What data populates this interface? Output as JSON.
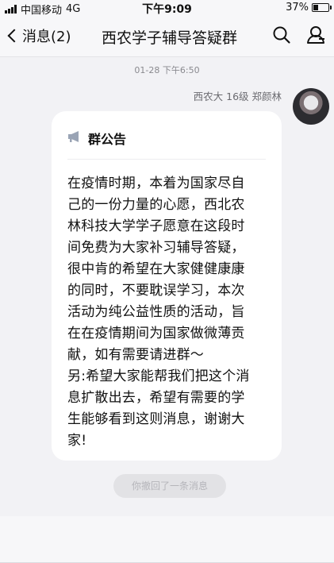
{
  "status_bar": {
    "carrier": "中国移动",
    "network": "4G",
    "time": "下午9:09",
    "battery": "37%",
    "battery_level": 0.37
  },
  "nav": {
    "back_label": "消息(2)",
    "title": "西农学子辅导答疑群",
    "icons": [
      "search-icon",
      "group-members-icon"
    ]
  },
  "chat": {
    "timestamp": "01-28 下午6:50",
    "sender": "西农大 16级 郑颜林",
    "announcement": {
      "icon": "megaphone-icon",
      "title": "群公告",
      "lines": [
        "在疫情时期，本着为国家尽自",
        "己的一份力量的心愿，西北农",
        "林科技大学学子愿意在这段时",
        "间免费为大家补习辅导答疑，",
        "很中肯的希望在大家健健康康",
        "的同时，不要耽误学习，本次",
        "活动为纯公益性质的活动，旨",
        "在在疫情期间为国家做微薄贡",
        "献，如有需要请进群～",
        "另:希望大家能帮我们把这个消",
        "息扩散出去，希望有需要的学",
        "生能够看到这则消息，谢谢大",
        "家!"
      ]
    },
    "recall_notice": "你撤回了一条消息"
  }
}
